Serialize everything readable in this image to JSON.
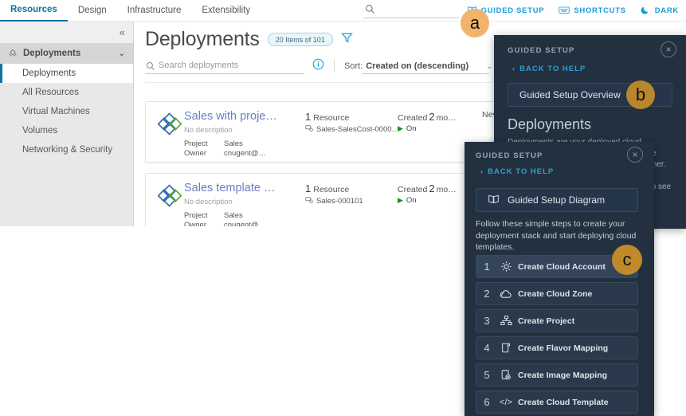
{
  "topnav": {
    "tabs": [
      {
        "label": "Resources",
        "active": true
      },
      {
        "label": "Design",
        "active": false
      },
      {
        "label": "Infrastructure",
        "active": false
      },
      {
        "label": "Extensibility",
        "active": false
      }
    ],
    "search_placeholder": "",
    "links": [
      {
        "label": "GUIDED SETUP",
        "icon": "map-book-icon"
      },
      {
        "label": "SHORTCUTS",
        "icon": "keyboard-icon"
      },
      {
        "label": "DARK",
        "icon": "moon-icon"
      }
    ]
  },
  "sidebar": {
    "collapse_icon": "«",
    "group": {
      "label": "Deployments",
      "icon": "deployments-icon",
      "chevron": "⌄"
    },
    "items": [
      {
        "label": "Deployments",
        "active": true
      },
      {
        "label": "All Resources",
        "active": false
      },
      {
        "label": "Virtual Machines",
        "active": false
      },
      {
        "label": "Volumes",
        "active": false
      },
      {
        "label": "Networking & Security",
        "active": false
      }
    ]
  },
  "main": {
    "title": "Deployments",
    "count_badge": "20 Items of 101",
    "filter_icon": "funnel-icon",
    "search": {
      "placeholder": "Search deployments",
      "value": ""
    },
    "info_icon": "info-circle-icon",
    "sort": {
      "label": "Sort:",
      "value": "Created on (descending)"
    },
    "views": [
      {
        "name": "list-view",
        "icon": "list-icon",
        "active": true
      },
      {
        "name": "grid-view",
        "icon": "grid-icon",
        "active": false
      }
    ],
    "cards": [
      {
        "title": "Sales with proje…",
        "description": "No description",
        "project_label": "Project",
        "project_value": "Sales",
        "owner_label": "Owner",
        "owner_value": "cnugent@…",
        "resource_count": "1",
        "resource_word": "Resource",
        "resource_name": "Sales-SalesCost-0000…",
        "created_label": "Created",
        "created_num": "2",
        "created_unit": "mo…",
        "power_state": "On",
        "expiry": "Never exp"
      },
      {
        "title": "Sales template …",
        "description": "No description",
        "project_label": "Project",
        "project_value": "Sales",
        "owner_label": "Owner",
        "owner_value": "cnugent@…",
        "resource_count": "1",
        "resource_word": "Resource",
        "resource_name": "Sales-000101",
        "created_label": "Created",
        "created_num": "2",
        "created_unit": "mo…",
        "power_state": "On",
        "expiry": ""
      }
    ]
  },
  "guided_setup_overview_panel": {
    "header": "GUIDED SETUP",
    "close_icon": "×",
    "back_link": "BACK TO HELP",
    "button_label": "Guided Setup Overview",
    "section_title": "Deployments",
    "body": "Deployments are your deployed cloud templates. They can be deployed from the catalog or using the cloud template designer. Use the card menus to manage your deployments. Select a deployment card to see details on the deployment details page."
  },
  "guided_setup_steps_panel": {
    "header": "GUIDED SETUP",
    "close_icon": "×",
    "back_link": "BACK TO HELP",
    "diagram_button": "Guided Setup Diagram",
    "diagram_icon": "map-book-icon",
    "intro": "Follow these simple steps to create your deployment stack and start deploying cloud templates.",
    "steps": [
      {
        "num": "1",
        "label": "Create Cloud Account",
        "icon": "gear-icon",
        "highlighted": true
      },
      {
        "num": "2",
        "label": "Create Cloud Zone",
        "icon": "cloud-icon",
        "highlighted": false
      },
      {
        "num": "3",
        "label": "Create Project",
        "icon": "org-chart-icon",
        "highlighted": false
      },
      {
        "num": "4",
        "label": "Create Flavor Mapping",
        "icon": "flavor-icon",
        "highlighted": false
      },
      {
        "num": "5",
        "label": "Create Image Mapping",
        "icon": "image-gear-icon",
        "highlighted": false
      },
      {
        "num": "6",
        "label": "Create Cloud Template",
        "icon": "code-icon",
        "highlighted": false
      }
    ]
  },
  "callouts": [
    {
      "id": "a",
      "label": "a",
      "color": "#f2b36a"
    },
    {
      "id": "b",
      "label": "b",
      "color": "#b8862c"
    },
    {
      "id": "c",
      "label": "c",
      "color": "#bf8a2b"
    }
  ]
}
